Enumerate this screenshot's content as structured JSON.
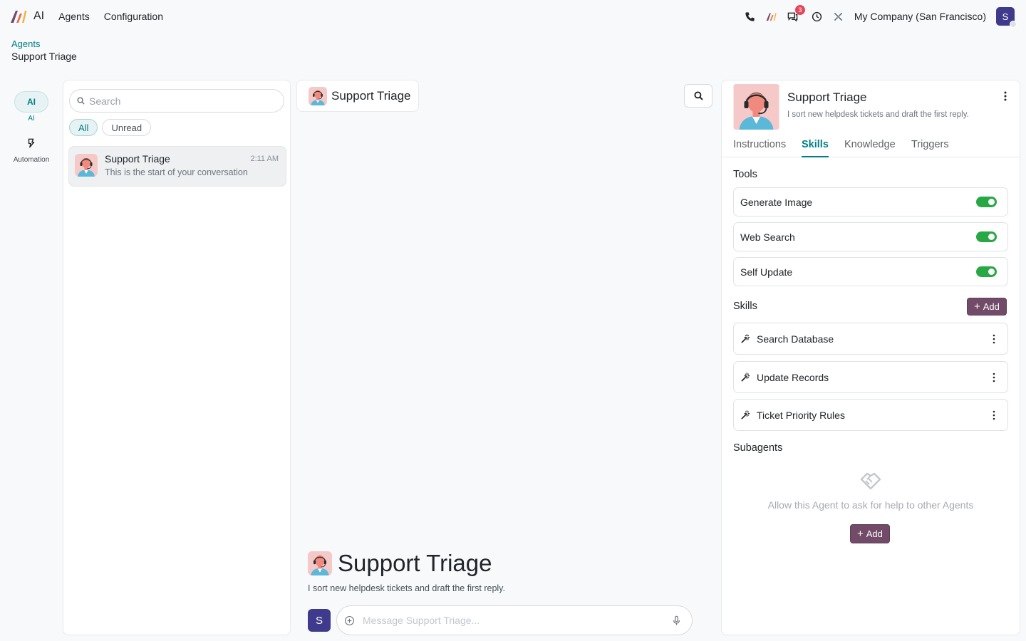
{
  "topbar": {
    "app_name": "AI",
    "nav": [
      "Agents",
      "Configuration"
    ],
    "chat_badge": "3",
    "company": "My Company (San Francisco)",
    "user_initial": "S"
  },
  "breadcrumb": {
    "parent": "Agents",
    "current": "Support Triage"
  },
  "rail": {
    "items": [
      {
        "icon_text": "AI",
        "label": "AI"
      },
      {
        "label": "Automation"
      }
    ]
  },
  "list": {
    "search_placeholder": "Search",
    "filters": [
      "All",
      "Unread"
    ],
    "conversation": {
      "title": "Support Triage",
      "subtitle": "This is the start of your conversation",
      "time": "2:11 AM"
    }
  },
  "chat": {
    "header_title": "Support Triage",
    "welcome_title": "Support Triage",
    "welcome_sub": "I sort new helpdesk tickets and draft the first reply.",
    "composer_placeholder": "Message Support Triage...",
    "user_initial": "S"
  },
  "agent": {
    "name": "Support Triage",
    "description": "I sort new helpdesk tickets and draft the first reply.",
    "tabs": [
      "Instructions",
      "Skills",
      "Knowledge",
      "Triggers"
    ],
    "active_tab": "Skills",
    "tools_title": "Tools",
    "tools": [
      {
        "label": "Generate Image",
        "enabled": true
      },
      {
        "label": "Web Search",
        "enabled": true
      },
      {
        "label": "Self Update",
        "enabled": true
      }
    ],
    "skills_title": "Skills",
    "add_label": "Add",
    "skills": [
      "Search Database",
      "Update Records",
      "Ticket Priority Rules"
    ],
    "subagents_title": "Subagents",
    "subagents_empty": "Allow this Agent to ask for help to other Agents",
    "subagents_add_label": "Add"
  },
  "colors": {
    "accent": "#017e84",
    "primary": "#714b67",
    "toggle_on": "#28a745",
    "avatar": "#3f3a8b"
  }
}
